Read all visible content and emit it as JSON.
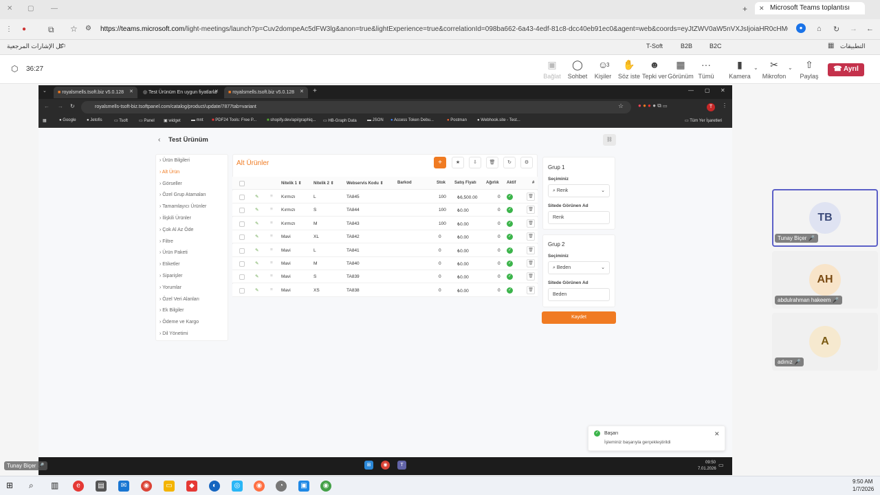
{
  "outer_browser": {
    "active_tab": "Microsoft Teams toplantısı",
    "url_host": "https://teams.microsoft.com",
    "url_path": "/light-meetings/launch?p=Cuv2dompeAc5dFW3lg&anon=true&lightExperience=true&correlationId=098ba662-6a43-4edf-81c8-dcc40eb91ec0&agent=web&coords=eyJtZWV0aW5nVXJsIjoiaHR0cHM6Ly90ZWFtcy5...",
    "bookmarks_right_label": "كل الإشارات المرجعية",
    "bookmarks": [
      "T-Soft",
      "B2B",
      "B2C"
    ],
    "apps_label": "التطبيقات"
  },
  "teams": {
    "timer": "36:27",
    "controls": [
      {
        "icon": "shield-icon",
        "label": "Bağlat"
      },
      {
        "icon": "chat-icon",
        "label": "Sohbet"
      },
      {
        "icon": "people-icon",
        "label": "Kişiler",
        "count": "3"
      },
      {
        "icon": "hand-icon",
        "label": "Söz iste"
      },
      {
        "icon": "emoji-icon",
        "label": "Tepki ver"
      },
      {
        "icon": "grid-icon",
        "label": "Görünüm"
      },
      {
        "icon": "more-icon",
        "label": "Tümü"
      }
    ],
    "camera_label": "Kamera",
    "mic_label": "Mikrofon",
    "share_label": "Paylaş",
    "leave_label": "Ayrıl"
  },
  "inner_browser": {
    "tabs": [
      "royalsmells.tsoft.biz v5.0.128",
      "Test Ürünüm En uygun fiyatlarla",
      "royalsmells.tsoft.biz v5.0.128"
    ],
    "url": "royalsmells-tsoft-biz.tsoftpanel.com/catalog/product/update/7877tab=variant",
    "bookmarks": [
      "Google",
      "Jetofis",
      "Tsoft",
      "Panel",
      "widget",
      "mnt",
      "PDF24 Tools: Free P...",
      "shopify.dev/api/graphiq...",
      "HB-Graph Data",
      "JSON",
      "Access Token Debu...",
      "Postman",
      "Webhook.site - Test..."
    ],
    "all_bookmarks": "Tüm Yer İşaretleri",
    "profile_initial": "T"
  },
  "page": {
    "title": "Test Ürünüm",
    "menu": [
      "Ürün Bilgileri",
      "Alt Ürün",
      "Görseller",
      "Özel Grup Atamaları",
      "Tamamlayıcı Ürünler",
      "İlişkili Ürünler",
      "Çok Al Az Öde",
      "Filtre",
      "Ürün Paketi",
      "Etiketler",
      "Siparişler",
      "Yorumlar",
      "Özel Veri Alanları",
      "Ek Bilgiler",
      "Ödeme ve Kargo",
      "Dil Yönetimi"
    ],
    "active_menu_index": 1,
    "table_title": "Alt Ürünler",
    "columns": [
      "Nitelik 1",
      "Nitelik 2",
      "Webservis Kodu",
      "Barkod",
      "Stok",
      "Satış Fiyatı",
      "Ağırlık",
      "Aktif",
      "#"
    ],
    "rows": [
      {
        "n1": "Kırmızı",
        "n2": "L",
        "code": "TA845",
        "stock": "100",
        "price": "₺6,500.00",
        "weight": "0"
      },
      {
        "n1": "Kırmızı",
        "n2": "S",
        "code": "TA844",
        "stock": "100",
        "price": "₺0.00",
        "weight": "0"
      },
      {
        "n1": "Kırmızı",
        "n2": "M",
        "code": "TA843",
        "stock": "100",
        "price": "₺0.00",
        "weight": "0"
      },
      {
        "n1": "Mavi",
        "n2": "XL",
        "code": "TA842",
        "stock": "0",
        "price": "₺0.00",
        "weight": "0"
      },
      {
        "n1": "Mavi",
        "n2": "L",
        "code": "TA841",
        "stock": "0",
        "price": "₺0.00",
        "weight": "0"
      },
      {
        "n1": "Mavi",
        "n2": "M",
        "code": "TA840",
        "stock": "0",
        "price": "₺0.00",
        "weight": "0"
      },
      {
        "n1": "Mavi",
        "n2": "S",
        "code": "TA839",
        "stock": "0",
        "price": "₺0.00",
        "weight": "0"
      },
      {
        "n1": "Mavi",
        "n2": "XS",
        "code": "TA838",
        "stock": "0",
        "price": "₺0.00",
        "weight": "0"
      }
    ],
    "group1": {
      "title": "Grup 1",
      "select_label": "Seçiminiz",
      "select_value": "Renk",
      "display_label": "Sitede Görünen Ad",
      "display_value": "Renk"
    },
    "group2": {
      "title": "Grup 2",
      "select_label": "Seçiminiz",
      "select_value": "Beden",
      "display_label": "Sitede Görünen Ad",
      "display_value": "Beden"
    },
    "save_label": "Kaydet",
    "toast_title": "Başarı",
    "toast_text": "İşleminiz başarıyla gerçekleştirildi"
  },
  "inner_taskbar": {
    "time": "09:50",
    "date": "7.01.2026"
  },
  "participants": [
    {
      "initials": "TB",
      "name": "Tunay Biçer"
    },
    {
      "initials": "AH",
      "name": "abdulrahman hakeem"
    },
    {
      "initials": "A",
      "name": "adınız"
    }
  ],
  "self_label": "Tunay Biçer",
  "taskbar": {
    "time": "9:50 AM",
    "date": "1/7/2026"
  },
  "colors": {
    "accent": "#f07b22",
    "teams_leave": "#c4314b",
    "success": "#3cb44b",
    "tile_border": "#5b5fc7"
  }
}
